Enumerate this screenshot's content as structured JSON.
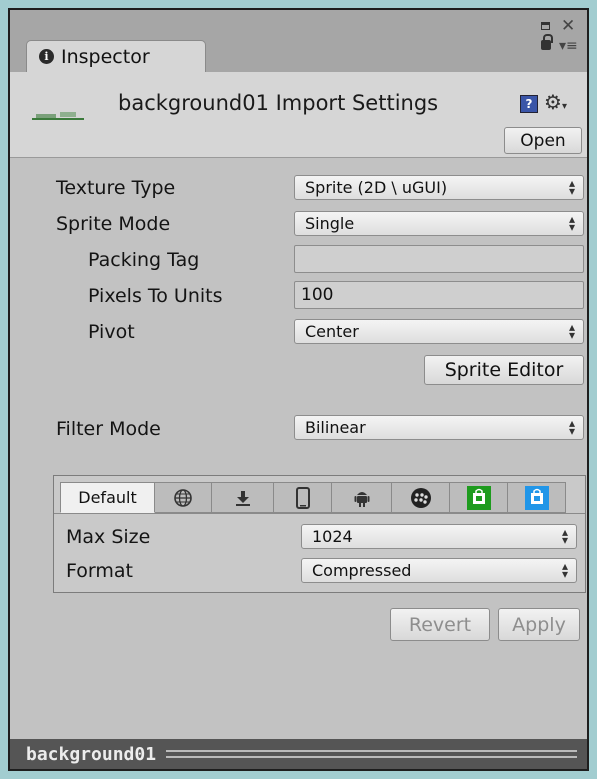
{
  "window": {
    "tab_title": "Inspector",
    "icons": {
      "tab": "info-icon",
      "maximize": "maximize-icon",
      "close": "close-icon",
      "lock": "lock-icon",
      "menu": "menu-icon"
    }
  },
  "header": {
    "title": "background01 Import Settings",
    "open_button": "Open",
    "icons": {
      "help": "help-icon",
      "settings": "gear-icon"
    }
  },
  "settings": {
    "texture_type": {
      "label": "Texture Type",
      "value": "Sprite (2D \\ uGUI)"
    },
    "sprite_mode": {
      "label": "Sprite Mode",
      "value": "Single"
    },
    "packing_tag": {
      "label": "Packing Tag",
      "value": ""
    },
    "pixels_to_units": {
      "label": "Pixels To Units",
      "value": "100"
    },
    "pivot": {
      "label": "Pivot",
      "value": "Center"
    },
    "sprite_editor_button": "Sprite Editor",
    "filter_mode": {
      "label": "Filter Mode",
      "value": "Bilinear"
    }
  },
  "platform": {
    "tabs": [
      {
        "label": "Default",
        "icon": ""
      },
      {
        "label": "",
        "icon": "web-icon"
      },
      {
        "label": "",
        "icon": "standalone-download-icon"
      },
      {
        "label": "",
        "icon": "mobile-icon"
      },
      {
        "label": "",
        "icon": "android-icon"
      },
      {
        "label": "",
        "icon": "blackberry-icon"
      },
      {
        "label": "",
        "icon": "windows-store-green-icon"
      },
      {
        "label": "",
        "icon": "windows-phone-icon"
      }
    ],
    "max_size": {
      "label": "Max Size",
      "value": "1024"
    },
    "format": {
      "label": "Format",
      "value": "Compressed"
    }
  },
  "actions": {
    "revert": "Revert",
    "apply": "Apply"
  },
  "status_bar": {
    "asset_name": "background01"
  },
  "colors": {
    "win_bg": "#c2c2c2",
    "status_bg": "#555555",
    "outer_bg": "#a2cdd0",
    "store_green": "#1e9b1e",
    "phone_blue": "#2196e8"
  }
}
